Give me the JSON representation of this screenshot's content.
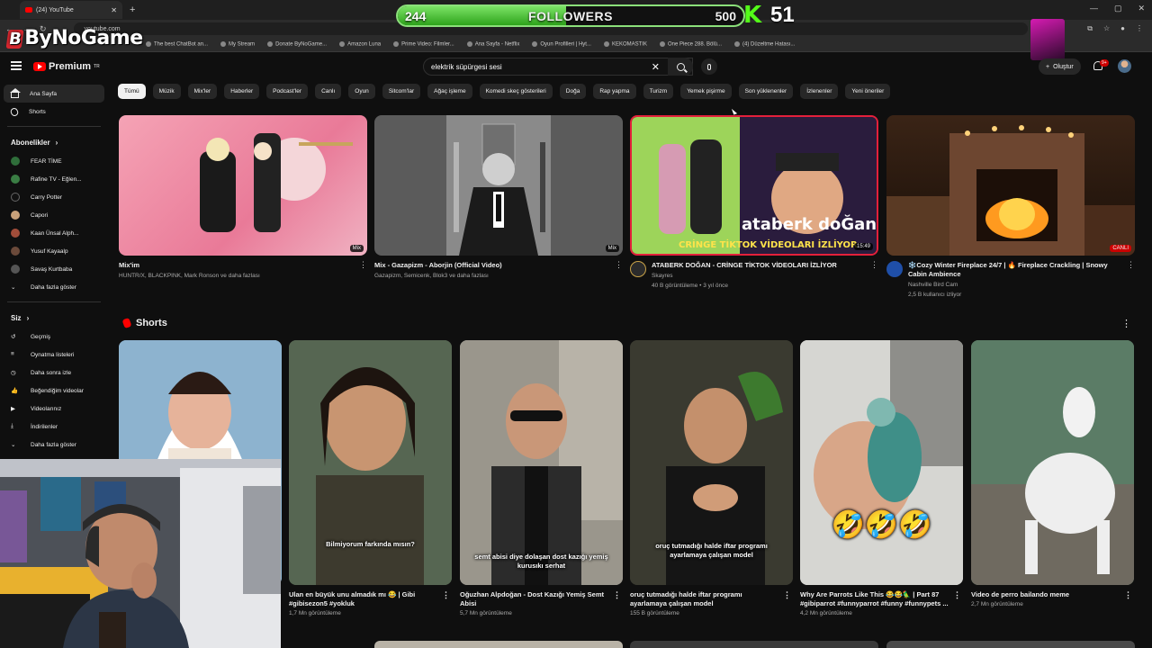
{
  "browser": {
    "tab_title": "(24) YouTube",
    "url": "youtube.com",
    "bookmarks": [
      "The best ChatBot an...",
      "My Stream",
      "Donate ByNoGame...",
      "Amazon Luna",
      "Prime Video: Filmler...",
      "Ana Sayfa - Netflix",
      "Oyun Profilleri | Hyt...",
      "KEKOMASTIK",
      "One Piece 288. Bölü...",
      "(4) Düzeltme Hatası..."
    ]
  },
  "overlay": {
    "brand": "ByNoGame",
    "followers_current": "244",
    "followers_label": "FOLLOWERS",
    "followers_goal": "500",
    "followers_progress": 0.488,
    "viewer_count": "51"
  },
  "youtube": {
    "logo": "Premium",
    "logo_tm": "TR",
    "search_value": "elektrik süpürgesi sesi",
    "create_label": "Oluştur",
    "notif_badge": "9+"
  },
  "sidebar": {
    "home": "Ana Sayfa",
    "shorts": "Shorts",
    "subs_header": "Abonelikler",
    "subscriptions": [
      "FEAR TİME",
      "Rafine TV - Eğlen...",
      "Carry Potter",
      "Capori",
      "Kaan Ünsal Alph...",
      "Yusuf Kayaalp",
      "Savaş Kurtbaba"
    ],
    "show_more": "Daha fazla göster",
    "you_header": "Siz",
    "you_items": [
      "Geçmiş",
      "Oynatma listeleri",
      "Daha sonra izle",
      "Beğendiğim videolar",
      "Videolarınız",
      "İndirilenler",
      "Daha fazla göster"
    ]
  },
  "chips": [
    "Tümü",
    "Müzik",
    "Mix'ler",
    "Haberler",
    "Podcast'ler",
    "Canlı",
    "Oyun",
    "Sitcom'lar",
    "Ağaç işleme",
    "Komedi skeç gösterileri",
    "Doğa",
    "Rap yapma",
    "Turizm",
    "Yemek pişirme",
    "Son yüklenenler",
    "İzlenenler",
    "Yeni öneriler"
  ],
  "videos": [
    {
      "title": "Mix'im",
      "sub1": "HUNTR/X, BLACKPINK, Mark Ronson ve daha fazlası",
      "sub2": "",
      "tag": "Mix"
    },
    {
      "title": "Mix - Gazapizm - Aborjin (Official Video)",
      "sub1": "Gazapizm, Semicenk, Blok3 ve daha fazlası",
      "sub2": "",
      "tag": "Mix"
    },
    {
      "title": "ATABERK DOĞAN - CRİNGE TİKTOK VİDEOLARI İZLİYOR",
      "sub1": "Skayres",
      "sub2": "40 B görüntüleme • 3 yıl önce",
      "tag": "15:49",
      "thumb_text1": "ataberk doĞan",
      "thumb_text2": "CRİNGE TİKTOK VİDEOLARI İZLİYOR"
    },
    {
      "title": "❄️Cozy Winter Fireplace 24/7 | 🔥 Fireplace Crackling | Snowy Cabin Ambience",
      "sub1": "Nashville Bird Cam",
      "sub2": "2,5 B kullanıcı izliyor",
      "tag": "CANLI"
    }
  ],
  "shorts_header": "Shorts",
  "shorts": [
    {
      "title": "",
      "views": "",
      "caption": ""
    },
    {
      "title": "Ulan en büyük unu almadık mı 😂 | Gibi #gibisezon5 #yokluk",
      "views": "1,7 Mn görüntüleme",
      "caption": "Bilmiyorum farkında mısın?"
    },
    {
      "title": "Oğuzhan Alpdoğan - Dost Kazığı Yemiş Semt Abisi",
      "views": "5,7 Mn görüntüleme",
      "caption": "semt abisi diye dolaşan dost kazığı yemiş kurusıkı serhat"
    },
    {
      "title": "oruç tutmadığı halde iftar programı ayarlamaya çalışan model",
      "views": "155 B görüntüleme",
      "caption": "oruç tutmadığı halde iftar programı ayarlamaya çalışan model"
    },
    {
      "title": "Why Are Parrots Like This 😂😂🦜 | Part 87 #gibiparrot #funnyparrot #funny #funnypets ...",
      "views": "4,2 Mn görüntüleme",
      "caption": "🤣🤣🤣"
    },
    {
      "title": "Video de perro bailando meme",
      "views": "2,7 Mn görüntüleme",
      "caption": ""
    }
  ]
}
